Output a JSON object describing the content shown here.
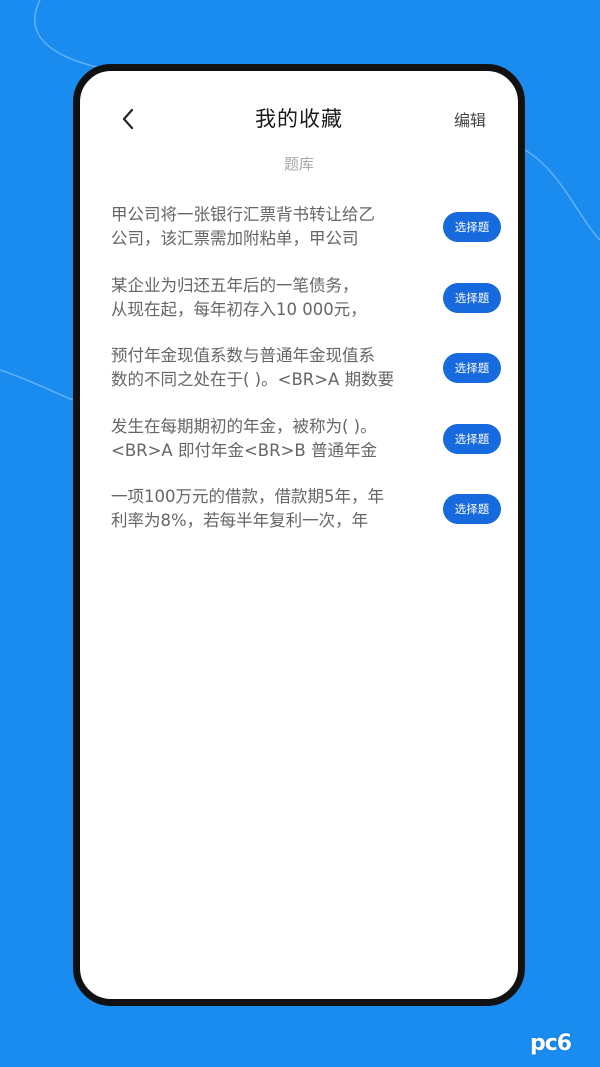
{
  "colors": {
    "background": "#1a8cf0",
    "badge": "#1769de",
    "text": "#666666",
    "title": "#1a1a1a"
  },
  "header": {
    "back_icon": "chevron-left-icon",
    "title": "我的收藏",
    "edit_label": "编辑"
  },
  "section_label": "题库",
  "items": [
    {
      "line1": "甲公司将一张银行汇票背书转让给乙",
      "line2": "公司，该汇票需加附粘单，甲公司",
      "badge": "选择题"
    },
    {
      "line1": "某企业为归还五年后的一笔债务，",
      "line2": "从现在起，每年初存入10 000元，",
      "badge": "选择题"
    },
    {
      "line1": "预付年金现值系数与普通年金现值系",
      "line2": "数的不同之处在于( )。<BR>A 期数要",
      "badge": "选择题"
    },
    {
      "line1": "发生在每期期初的年金，被称为( )。",
      "line2": "<BR>A 即付年金<BR>B 普通年金",
      "badge": "选择题"
    },
    {
      "line1": "一项100万元的借款，借款期5年，年",
      "line2": "利率为8%，若每半年复利一次，年",
      "badge": "选择题"
    }
  ],
  "watermark": {
    "text": "pc6"
  }
}
